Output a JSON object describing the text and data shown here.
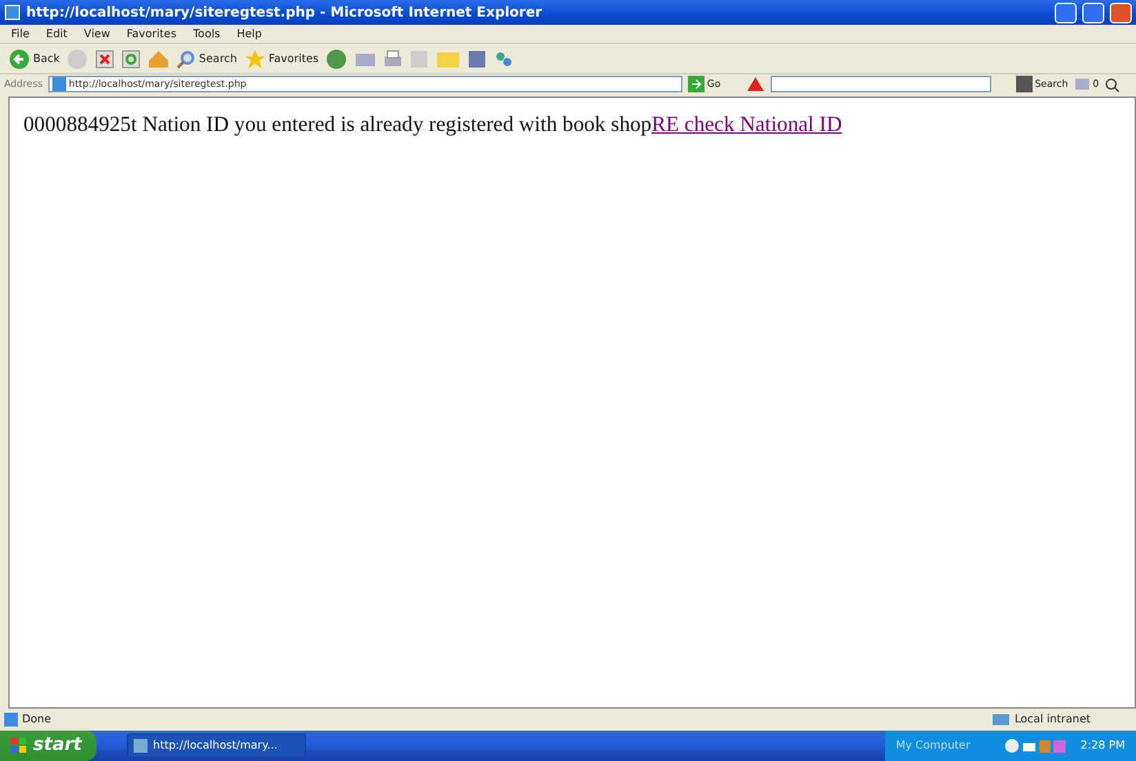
{
  "window": {
    "title": "http://localhost/mary/siteregtest.php - Microsoft Internet Explorer"
  },
  "menu": [
    "File",
    "Edit",
    "View",
    "Favorites",
    "Tools",
    "Help"
  ],
  "toolbar": {
    "back": "Back",
    "search": "Search",
    "favorites": "Favorites"
  },
  "address_bar": {
    "label": "Address",
    "value": "http://localhost/mary/siteregtest.php",
    "go": "Go"
  },
  "search_toolbar": {
    "search": "Search",
    "count": "0"
  },
  "content": {
    "message": "0000884925t Nation ID you entered is already registered with book shop",
    "link": "RE check National ID"
  },
  "status_bar": {
    "status": "Done",
    "zone": "Local intranet"
  },
  "taskbar": {
    "start": "start",
    "tasks": [
      {
        "label": "http://localhost/mary...",
        "selected": true
      }
    ],
    "tray_label": "My Computer",
    "clock": "2:28 PM"
  }
}
